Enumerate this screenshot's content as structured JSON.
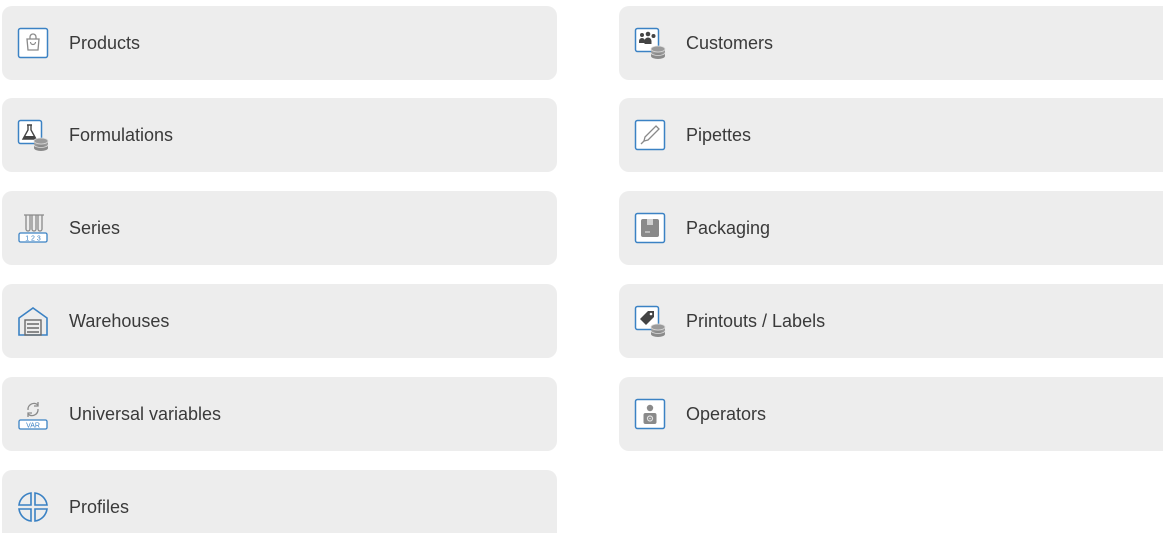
{
  "menu": {
    "left": [
      {
        "label": "Products",
        "icon": "shopping-bag-icon"
      },
      {
        "label": "Formulations",
        "icon": "flask-database-icon"
      },
      {
        "label": "Series",
        "icon": "test-tubes-icon"
      },
      {
        "label": "Warehouses",
        "icon": "warehouse-icon"
      },
      {
        "label": "Universal variables",
        "icon": "refresh-var-icon"
      },
      {
        "label": "Profiles",
        "icon": "profiles-icon"
      }
    ],
    "right": [
      {
        "label": "Customers",
        "icon": "customers-database-icon"
      },
      {
        "label": "Pipettes",
        "icon": "pipette-icon"
      },
      {
        "label": "Packaging",
        "icon": "packaging-box-icon"
      },
      {
        "label": "Printouts / Labels",
        "icon": "label-tag-database-icon"
      },
      {
        "label": "Operators",
        "icon": "operator-icon"
      }
    ]
  },
  "colors": {
    "tile_background": "#ededed",
    "icon_accent": "#3b82c4",
    "text": "#3a3a3a"
  }
}
